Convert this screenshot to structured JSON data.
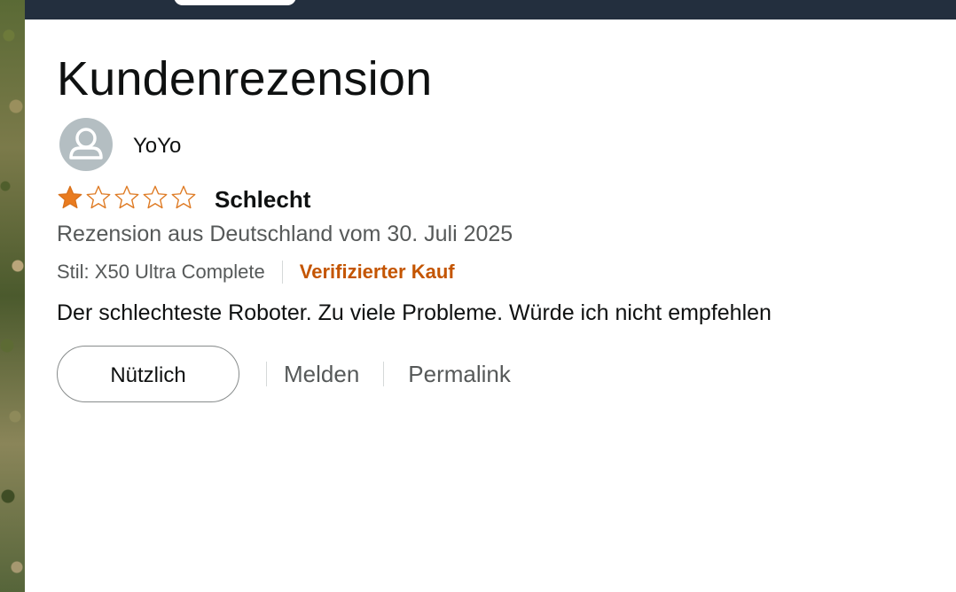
{
  "review": {
    "heading": "Kundenrezension",
    "author": {
      "name": "YoYo",
      "avatar_icon": "user-avatar-icon"
    },
    "rating": {
      "value": 1,
      "max": 5,
      "filled_color": "#f3a847",
      "outline_color": "#de7921",
      "title": "Schlecht"
    },
    "date_text": "Rezension aus Deutschland vom 30. Juli 2025",
    "style": "Stil: X50 Ultra Complete",
    "verified": "Verifizierter Kauf",
    "verified_color": "#c45500",
    "body": "Der schlechteste Roboter. Zu viele Probleme. Würde ich nicht empfehlen"
  },
  "actions": {
    "helpful_label": "Nützlich",
    "report_label": "Melden",
    "permalink_label": "Permalink"
  },
  "colors": {
    "topbar": "#232f3e",
    "text_primary": "#0f1111",
    "text_secondary": "#565959"
  }
}
